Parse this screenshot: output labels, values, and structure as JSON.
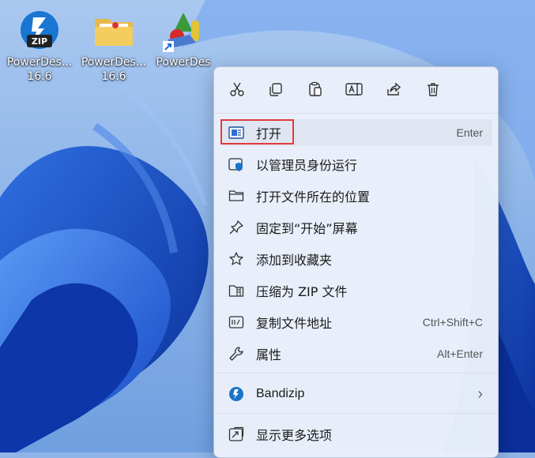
{
  "desktop": {
    "icons": [
      {
        "label_line1": "PowerDes...",
        "label_line2": "16.6",
        "icon": "zip-installer-icon"
      },
      {
        "label_line1": "PowerDes...",
        "label_line2": "16.6",
        "icon": "folder-icon"
      },
      {
        "label_line1": "PowerDes",
        "label_line2": "",
        "icon": "powerdesigner-shortcut-icon"
      }
    ]
  },
  "context_menu": {
    "quick_actions": [
      {
        "name": "cut-icon"
      },
      {
        "name": "copy-icon"
      },
      {
        "name": "paste-icon"
      },
      {
        "name": "rename-icon"
      },
      {
        "name": "share-icon"
      },
      {
        "name": "delete-icon"
      }
    ],
    "items": [
      {
        "label": "打开",
        "accelerator": "Enter",
        "icon": "open-icon"
      },
      {
        "label": "以管理员身份运行",
        "accelerator": "",
        "icon": "shield-icon"
      },
      {
        "label": "打开文件所在的位置",
        "accelerator": "",
        "icon": "folder-icon"
      },
      {
        "label": "固定到“开始”屏幕",
        "accelerator": "",
        "icon": "pin-icon"
      },
      {
        "label": "添加到收藏夹",
        "accelerator": "",
        "icon": "star-icon"
      },
      {
        "label": "压缩为 ZIP 文件",
        "accelerator": "",
        "icon": "zip-icon"
      },
      {
        "label": "复制文件地址",
        "accelerator": "Ctrl+Shift+C",
        "icon": "path-icon"
      },
      {
        "label": "属性",
        "accelerator": "Alt+Enter",
        "icon": "wrench-icon"
      },
      {
        "label": "Bandizip",
        "accelerator": "",
        "icon": "bandizip-icon",
        "submenu_arrow": "›"
      },
      {
        "label": "显示更多选项",
        "accelerator": "",
        "icon": "more-options-icon"
      }
    ]
  },
  "colors": {
    "highlight": "#e23b3b",
    "accent": "#1a73c8"
  }
}
